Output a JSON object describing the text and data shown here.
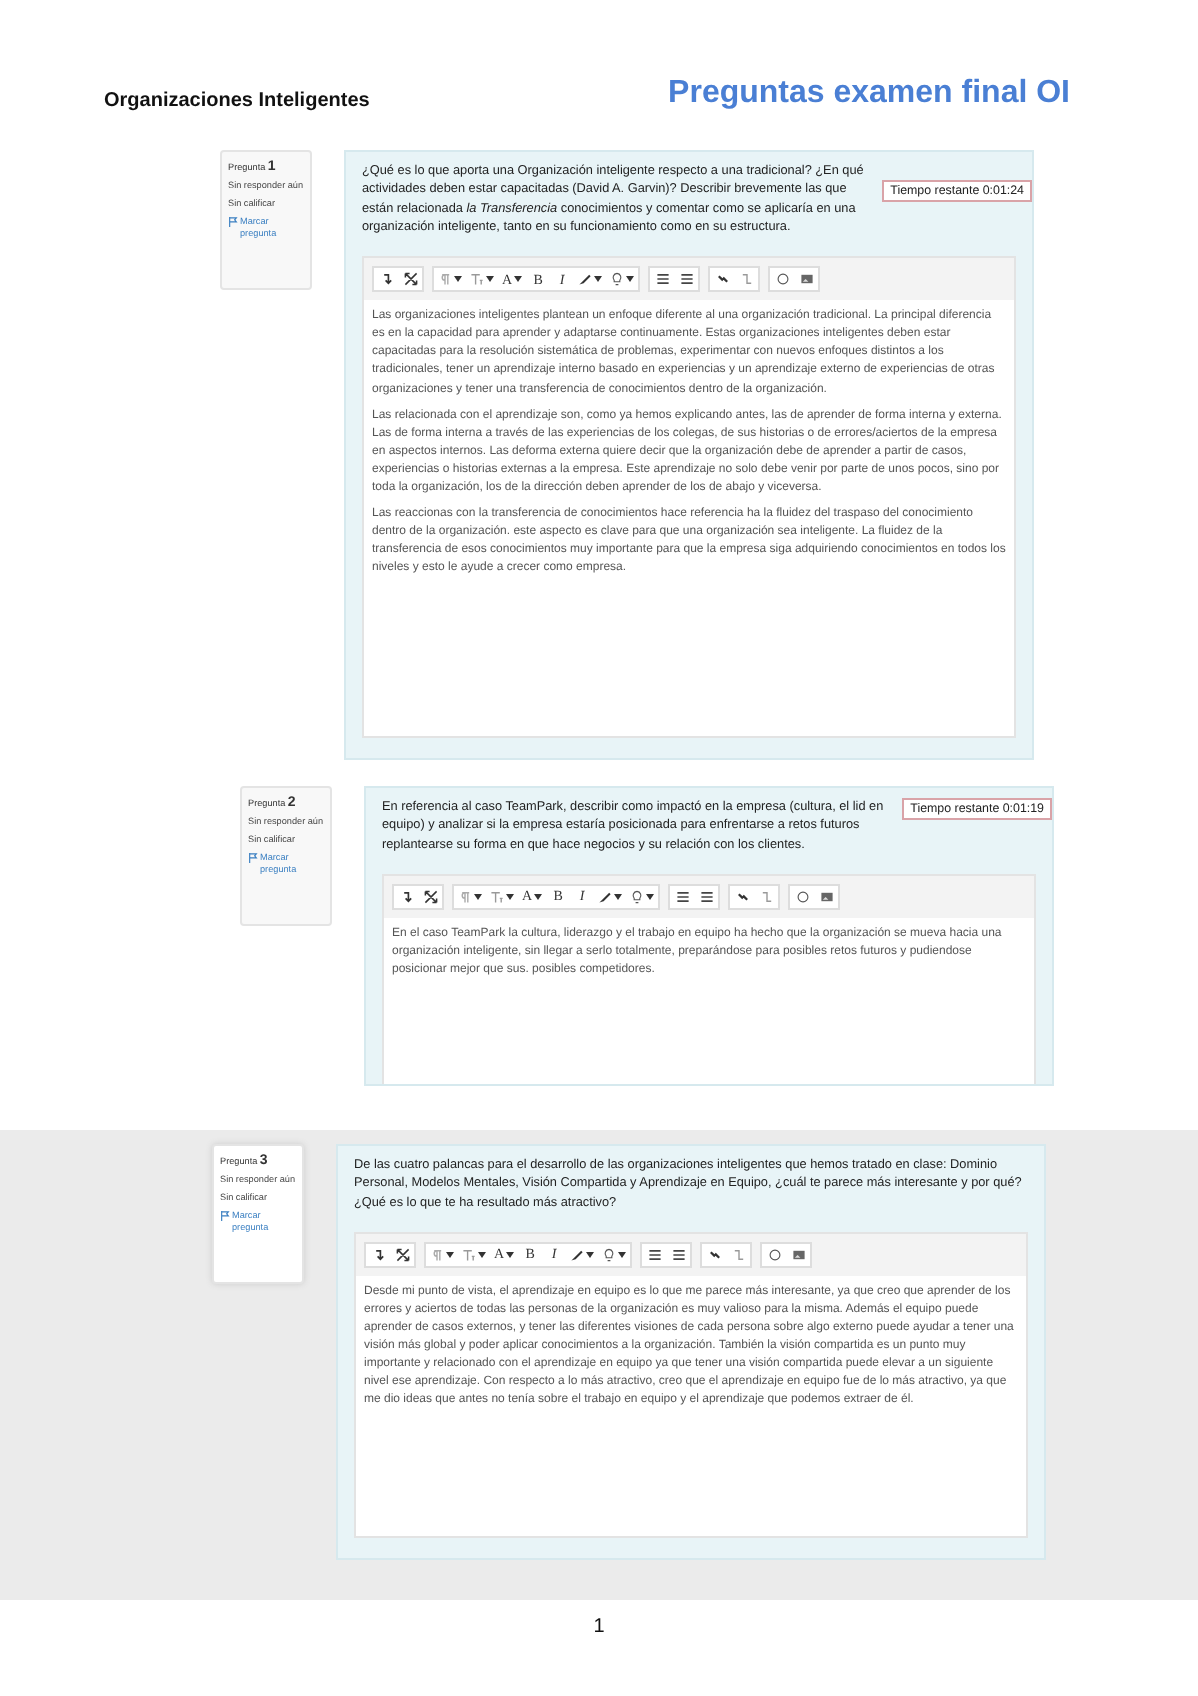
{
  "header": {
    "course": "Organizaciones Inteligentes",
    "title": "Preguntas examen final OI"
  },
  "questions": [
    {
      "label": "Pregunta",
      "number": "1",
      "status": "Sin responder aún",
      "grade": "Sin calificar",
      "flag": "Marcar pregunta",
      "timer": "Tiempo restante 0:01:24",
      "shaded": false,
      "text": "¿Qué es lo que aporta una Organización inteligente respecto a una tradicional? ¿En qué actividades deben estar capacitadas (David A. Garvin)? Describir brevemente las que están relacionada *la Transferencia* conocimientos y comentar como se aplicaría en una organización inteligente, tanto en su funcionamiento como en su estructura.",
      "toolbar": [
        [
          {
            "kind": "undo"
          },
          {
            "kind": "expand"
          }
        ],
        [
          {
            "kind": "para",
            "dropdown": true
          },
          {
            "kind": "size",
            "dropdown": true
          },
          {
            "kind": "font",
            "label": "A",
            "dropdown": true
          },
          {
            "kind": "bold",
            "label": "B"
          },
          {
            "kind": "italic",
            "label": "I"
          },
          {
            "kind": "pen",
            "dropdown": true
          },
          {
            "kind": "bulb",
            "dropdown": true
          }
        ],
        [
          {
            "kind": "ul"
          },
          {
            "kind": "ol"
          }
        ],
        [
          {
            "kind": "link"
          },
          {
            "kind": "unlink"
          }
        ],
        [
          {
            "kind": "emoji"
          },
          {
            "kind": "image"
          }
        ]
      ],
      "answer": [
        "Las organizaciones inteligentes plantean un enfoque diferente al una organización tradicional. La principal diferencia es en la capacidad para aprender y adaptarse continuamente. Estas organizaciones inteligentes deben estar capacitadas para la resolución sistemática de problemas, experimentar con nuevos enfoques distintos a los tradicionales, tener un aprendizaje interno basado en experiencias y un aprendizaje externo de  experiencias de otras organizaciones y tener una transferencia de conocimientos dentro de la organización.",
        "Las relacionada con el aprendizaje son, como ya hemos explicando antes, las de aprender de forma interna y externa. Las de forma interna a través de las experiencias de los colegas, de sus historias o de errores/aciertos de la empresa en aspectos internos. Las deforma externa quiere decir que la organización debe de aprender a partir de casos, experiencias o historias externas a la empresa. Este aprendizaje no solo debe venir por parte de unos pocos, sino por toda la organización, los de la dirección deben aprender de los de abajo y viceversa.",
        "Las reaccionas con la transferencia de conocimientos hace referencia ha la fluidez del traspaso del conocimiento dentro de la organización. este aspecto es clave para que una organización sea inteligente. La fluidez de la transferencia de esos conocimientos muy importante para que la empresa siga adquiriendo conocimientos en todos los niveles y esto le ayude a crecer como empresa."
      ]
    },
    {
      "label": "Pregunta",
      "number": "2",
      "status": "Sin responder aún",
      "grade": "Sin calificar",
      "flag": "Marcar pregunta",
      "timer": "Tiempo restante 0:01:19",
      "shaded": false,
      "text": "En referencia al caso TeamPark, describir como impactó en la  empresa (cultura, el lid en equipo) y analizar si la empresa estaría posicionada para enfrentarse a retos futuros replantearse su forma en que hace negocios y su relación con los clientes.",
      "toolbar": [
        [
          {
            "kind": "undo"
          },
          {
            "kind": "expand"
          }
        ],
        [
          {
            "kind": "para",
            "dropdown": true
          },
          {
            "kind": "size",
            "dropdown": true
          },
          {
            "kind": "font",
            "label": "A",
            "dropdown": true
          },
          {
            "kind": "bold",
            "label": "B"
          },
          {
            "kind": "italic",
            "label": "I"
          },
          {
            "kind": "pen",
            "dropdown": true
          },
          {
            "kind": "bulb",
            "dropdown": true
          }
        ],
        [
          {
            "kind": "ul"
          },
          {
            "kind": "ol"
          }
        ],
        [
          {
            "kind": "link"
          },
          {
            "kind": "unlink"
          }
        ],
        [
          {
            "kind": "emoji"
          },
          {
            "kind": "image"
          }
        ]
      ],
      "answer": [
        "En el caso TeamPark la cultura, liderazgo y el trabajo en equipo ha hecho que la organización se mueva hacia una organización inteligente, sin llegar a serlo totalmente, preparándose para posibles retos futuros y pudiendose posicionar mejor que sus. posibles competidores."
      ]
    },
    {
      "label": "Pregunta",
      "number": "3",
      "status": "Sin responder aún",
      "grade": "Sin calificar",
      "flag": "Marcar pregunta",
      "shaded": true,
      "text": "De las cuatro palancas para el desarrollo de las organizaciones inteligentes que hemos tratado en clase: Dominio Personal, Modelos Mentales, Visión Compartida y Aprendizaje en Equipo, ¿cuál te parece más interesante y por qué? ¿Qué es lo que te ha resultado más atractivo?",
      "toolbar": [
        [
          {
            "kind": "undo"
          },
          {
            "kind": "expand"
          }
        ],
        [
          {
            "kind": "para",
            "dropdown": true
          },
          {
            "kind": "size",
            "dropdown": true
          },
          {
            "kind": "font",
            "label": "A",
            "dropdown": true
          },
          {
            "kind": "bold",
            "label": "B"
          },
          {
            "kind": "italic",
            "label": "I"
          },
          {
            "kind": "pen",
            "dropdown": true
          },
          {
            "kind": "bulb",
            "dropdown": true
          }
        ],
        [
          {
            "kind": "ul"
          },
          {
            "kind": "ol"
          }
        ],
        [
          {
            "kind": "link"
          },
          {
            "kind": "unlink"
          }
        ],
        [
          {
            "kind": "emoji"
          },
          {
            "kind": "image"
          }
        ]
      ],
      "answer": [
        "Desde mi punto de vista, el aprendizaje en equipo es lo que me parece más interesante, ya que creo que aprender de los errores y aciertos de todas las personas de la organización es muy valioso para la misma. Además el equipo puede aprender de casos externos, y tener las diferentes visiones de cada persona sobre algo externo puede ayudar a tener una visión más global y poder aplicar conocimientos a la organización. También la visión compartida es un punto muy importante y relacionado con el aprendizaje en equipo ya que tener una visión compartida puede elevar a un siguiente nivel ese aprendizaje. Con respecto a lo más atractivo, creo que el aprendizaje en equipo fue de lo más atractivo, ya que me dio ideas que antes no tenía sobre el trabajo en equipo y el aprendizaje que podemos extraer de él."
      ]
    }
  ],
  "page_number": "1"
}
